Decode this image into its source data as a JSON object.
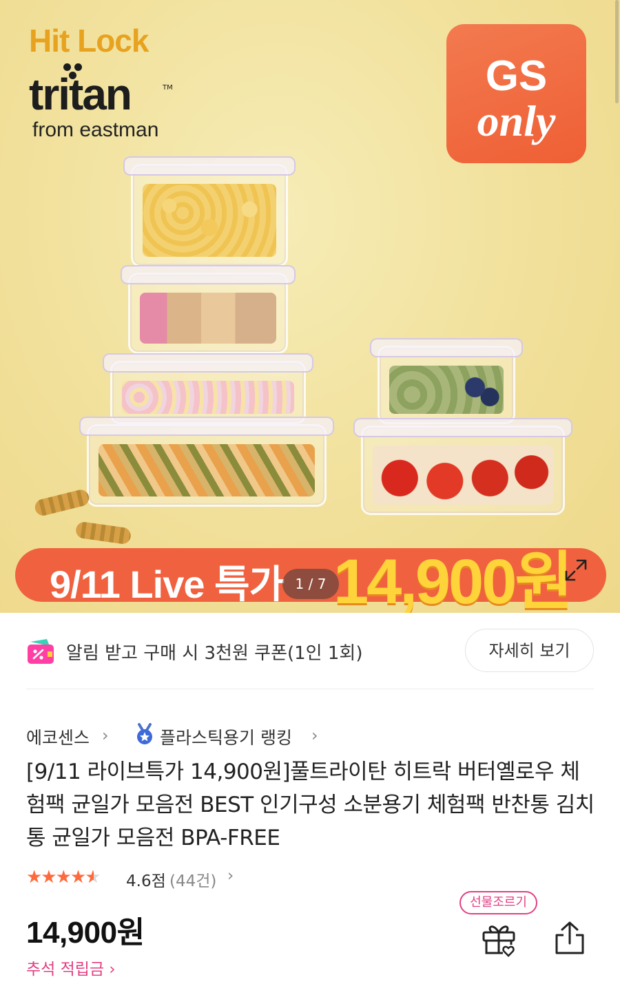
{
  "hero": {
    "brand_hit_lock": "Hit Lock",
    "brand_tritan": "tritan",
    "brand_tm": "TM",
    "brand_from": "from eastman",
    "badge_line1": "GS",
    "badge_line2": "only",
    "live_text": "9/11 Live 특가",
    "live_price": "14,900원",
    "image_counter": "1 / 7",
    "icons": [
      "expand-icon"
    ],
    "colors": {
      "badge": "#ef5f35",
      "banner": "#f0613f",
      "price_text": "#ffd33a",
      "brand_hit": "#e7a21f"
    }
  },
  "coupon": {
    "text": "알림 받고 구매 시 3천원 쿠폰(1인 1회)",
    "detail_button": "자세히 보기",
    "icon": "coupon-wallet-icon"
  },
  "product": {
    "store": "에코센스",
    "ranking": "플라스틱용기 랭킹",
    "title": "[9/11 라이브특가 14,900원]풀트라이탄 히트락 버터옐로우 체험팩 균일가 모음전 BEST 인기구성 소분용기 체험팩 반찬통 김치통 균일가 모음전 BPA-FREE",
    "rating": {
      "stars": 4.6,
      "score_text": "4.6점",
      "count_text": "(44건)"
    },
    "price": "14,900원",
    "points_text": "추석 적립금",
    "gift_tag": "선물조르기",
    "icons": [
      "ranking-medal-icon",
      "gift-icon",
      "share-icon"
    ],
    "colors": {
      "accent_pink": "#e23f82",
      "star": "#ff6a3d"
    }
  }
}
